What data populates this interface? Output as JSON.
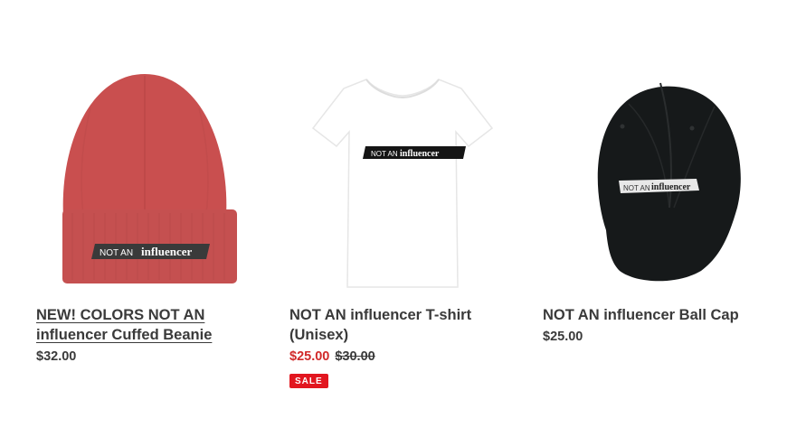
{
  "products": [
    {
      "title": "NEW! COLORS NOT AN influencer Cuffed Beanie",
      "price": "$32.00",
      "image_label_small": "NOT AN",
      "image_label_big": "influencer",
      "image_color": "#c84d4d"
    },
    {
      "title": "NOT AN influencer T-shirt (Unisex)",
      "sale_price": "$25.00",
      "compare_price": "$30.00",
      "badge": "SALE",
      "image_label_small": "NOT AN",
      "image_label_big": "influencer",
      "image_color": "#ffffff"
    },
    {
      "title": "NOT AN influencer Ball Cap",
      "price": "$25.00",
      "image_label_small": "NOT AN",
      "image_label_big": "influencer",
      "image_color": "#16191a"
    }
  ],
  "colors": {
    "sale_red": "#d12a2a",
    "badge_red": "#e2161f",
    "text": "#3a3a3a"
  }
}
